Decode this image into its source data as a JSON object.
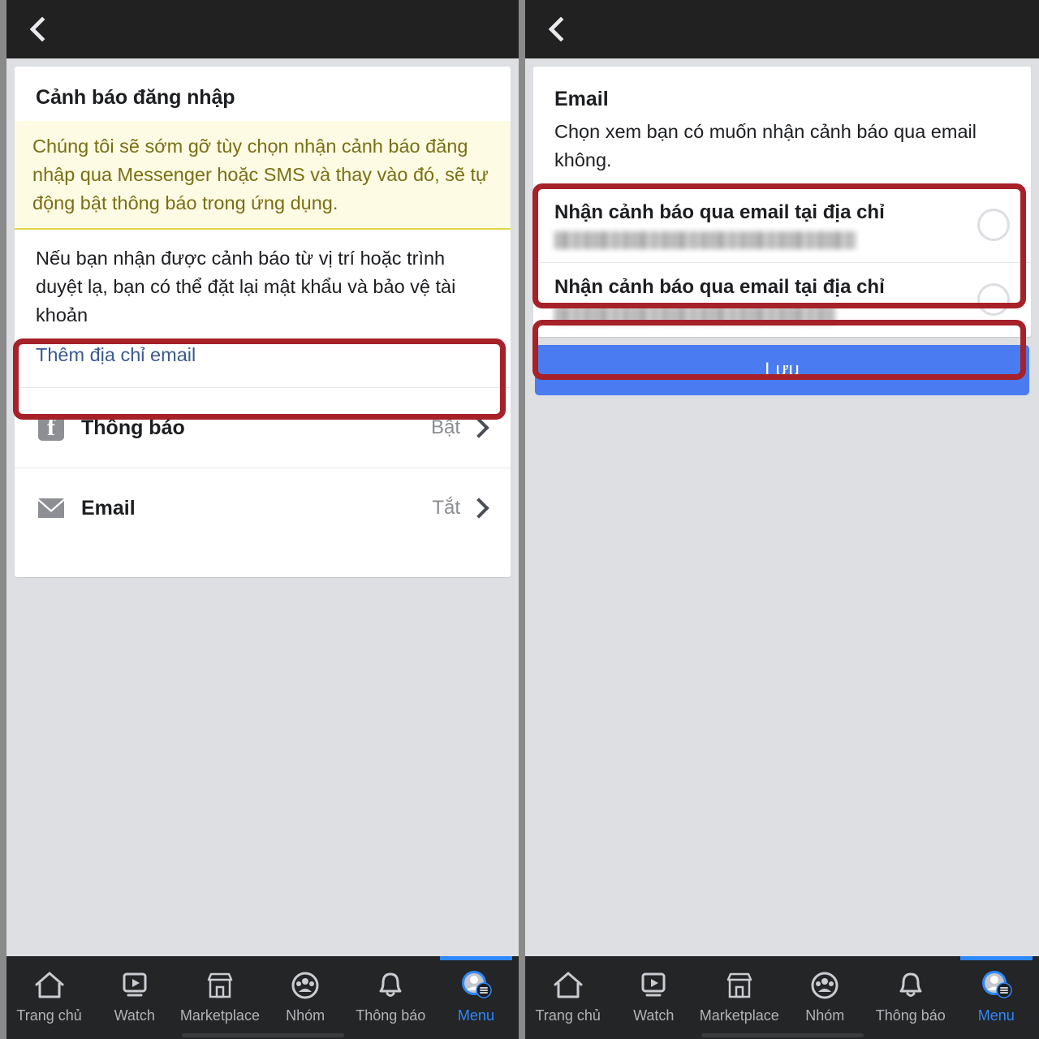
{
  "left_screen": {
    "back_label": "Quay lại",
    "card": {
      "title": "Cảnh báo đăng nhập",
      "notice": "Chúng tôi sẽ sớm gỡ tùy chọn nhận cảnh báo đăng nhập qua Messenger hoặc SMS và thay vào đó, sẽ tự động bật thông báo trong ứng dụng.",
      "body": "Nếu bạn nhận được cảnh báo từ vị trí hoặc trình duyệt lạ, bạn có thể đặt lại mật khẩu và bảo vệ tài khoản",
      "add_email_link": "Thêm địa chỉ email",
      "options": [
        {
          "icon": "facebook-icon",
          "label": "Thông báo",
          "state": "Bật"
        },
        {
          "icon": "envelope-icon",
          "label": "Email",
          "state": "Tắt"
        }
      ]
    }
  },
  "right_screen": {
    "back_label": "Quay lại",
    "card": {
      "title": "Email",
      "subtitle": "Chọn xem bạn có muốn nhận cảnh báo qua email không.",
      "choices": [
        {
          "label": "Nhận cảnh báo qua email tại địa chỉ",
          "address": "",
          "selected": false
        },
        {
          "label": "Nhận cảnh báo qua email tại địa chỉ",
          "address": "",
          "selected": false
        }
      ]
    },
    "save_button": "Lưu"
  },
  "bottom_nav": {
    "tabs": [
      {
        "icon": "home-icon",
        "label": "Trang chủ",
        "active": false
      },
      {
        "icon": "watch-play-icon",
        "label": "Watch",
        "active": false
      },
      {
        "icon": "marketplace-icon",
        "label": "Marketplace",
        "active": false
      },
      {
        "icon": "groups-icon",
        "label": "Nhóm",
        "active": false
      },
      {
        "icon": "bell-icon",
        "label": "Thông báo",
        "active": false
      },
      {
        "icon": "menu-avatar-icon",
        "label": "Menu",
        "active": true
      }
    ]
  },
  "colors": {
    "accent_blue": "#2d88ff",
    "save_blue": "#4a7bf0",
    "annotation_red": "#a62128",
    "notice_bg": "#fdfbe3",
    "notice_text": "#7a6f15",
    "page_bg": "#dddfe2",
    "topbar": "#212121",
    "nav_bg": "#242526"
  }
}
